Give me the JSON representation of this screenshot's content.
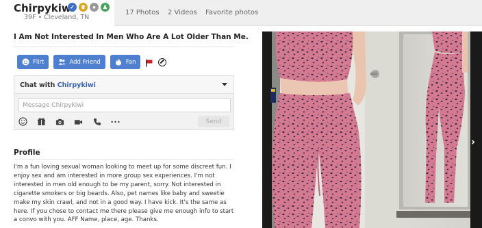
{
  "header": {
    "username": "Chirpykiwi",
    "subinfo": "39F • Cleveland, TN",
    "badges": [
      "verified-icon",
      "crown-icon",
      "gray-badge-icon",
      "person-icon"
    ]
  },
  "tabs": [
    {
      "label": "17 Photos"
    },
    {
      "label": "2 Videos"
    },
    {
      "label": "Favorite photos"
    }
  ],
  "headline": "I Am Not Interested In Men Who Are A Lot Older Than Me.",
  "actions": {
    "flirt": "Flirt",
    "add_friend": "Add Friend",
    "fan": "Fan"
  },
  "chat": {
    "label": "Chat with",
    "name": "Chirpykiwi",
    "placeholder": "Message Chirpykiwi",
    "send": "Send",
    "tools": [
      "smiley-icon",
      "gift-icon",
      "camera-icon",
      "video-icon",
      "phone-icon",
      "more-icon"
    ]
  },
  "profile": {
    "title": "Profile",
    "text": "I'm a fun loving sexual woman looking to meet up for some discreet fun. I enjoy sex and am interested in more group sex experiences. I'm not interested in men old enough to be my parent, sorry. Not interested in cigarette smokers or big beards. Also, pet names like baby and sweetie make my skin crawl, and not in a good way. I have kick. It's the same as here. If you chose to contact me there please give me enough info to start a convo with you. AFF Name, place, age. Thanks."
  },
  "colors": {
    "accent": "#4f7fcf",
    "link": "#3b63b5",
    "tab_bg": "#efefef"
  }
}
